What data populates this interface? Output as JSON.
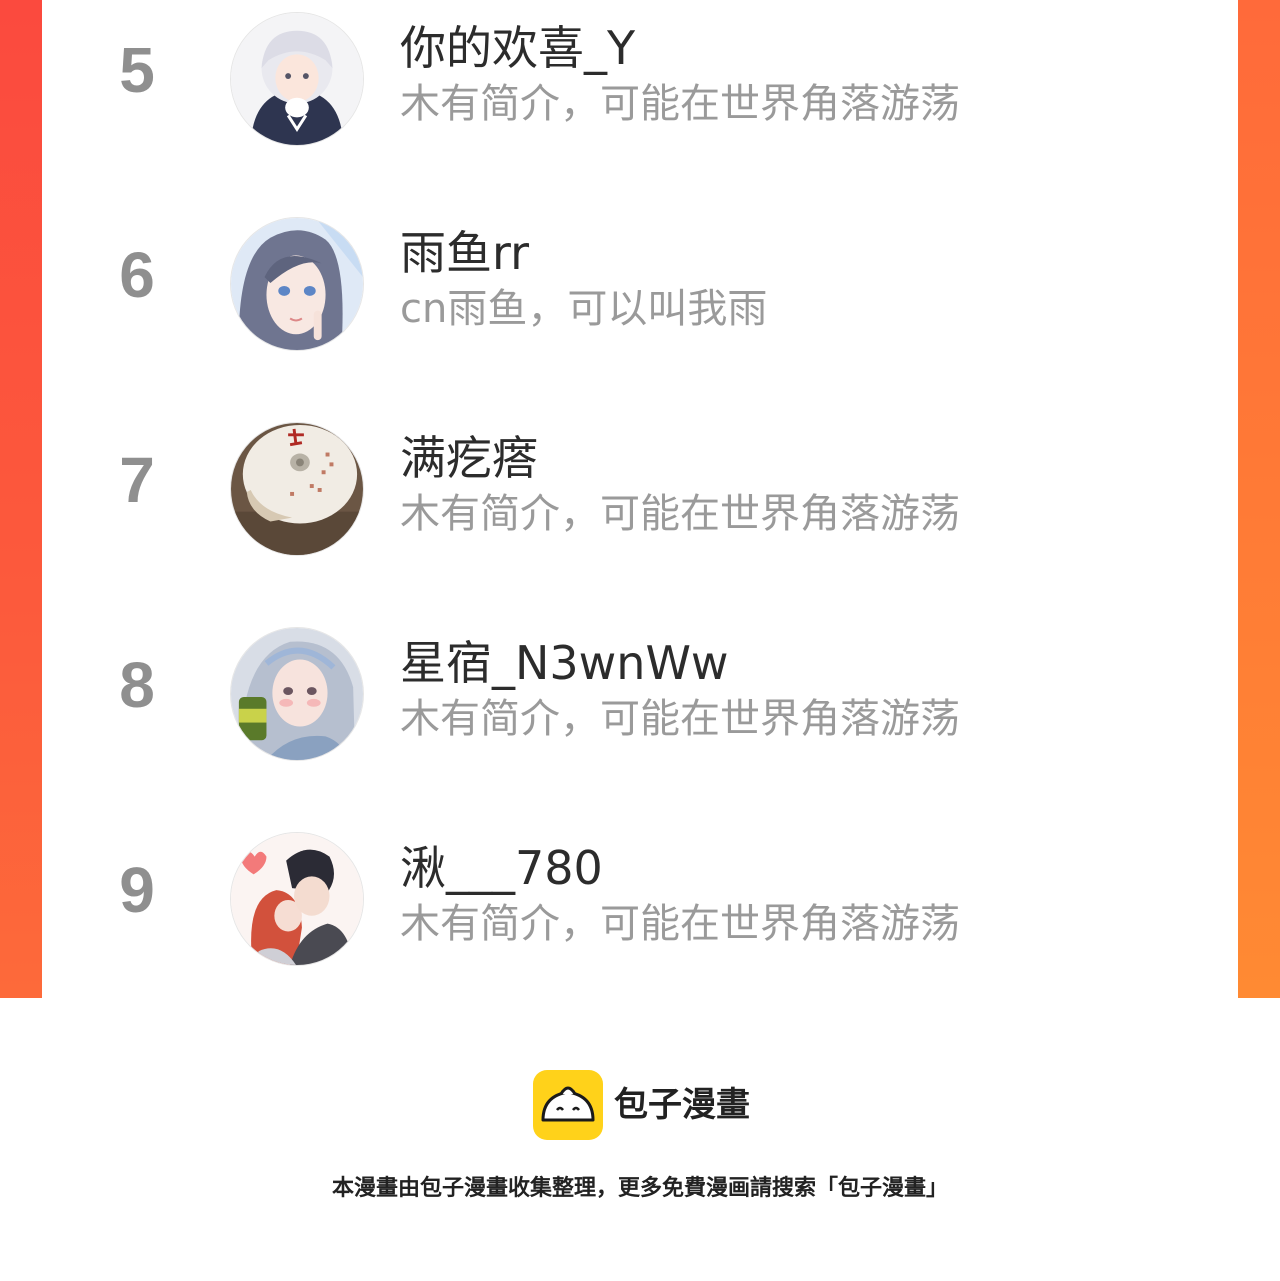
{
  "ranking": [
    {
      "rank": "5",
      "name": "你的欢喜_Y",
      "bio": "木有简介，可能在世界角落游荡",
      "avatar": "anime-girl-white-hair-avatar"
    },
    {
      "rank": "6",
      "name": "雨鱼rr",
      "bio": "cn雨鱼，可以叫我雨",
      "avatar": "anime-girl-blue-eyes-avatar"
    },
    {
      "rank": "7",
      "name": "满疙瘩",
      "bio": "木有简介，可能在世界角落游荡",
      "avatar": "porcelain-bowl-avatar"
    },
    {
      "rank": "8",
      "name": "星宿_N3wnWw",
      "bio": "木有简介，可能在世界角落游荡",
      "avatar": "girl-with-drink-can-avatar"
    },
    {
      "rank": "9",
      "name": "湫___780",
      "bio": "木有简介，可能在世界角落游荡",
      "avatar": "kissing-couple-avatar"
    }
  ],
  "footer": {
    "brand": "包子漫畫",
    "note": "本漫畫由包子漫畫收集整理，更多免費漫画請搜索「包子漫畫」",
    "logo_icon": "baozi-bun-icon"
  },
  "colors": {
    "left_border": "#fb4a3e",
    "right_border": "#ff7a36",
    "logo": "#ffd21a"
  }
}
